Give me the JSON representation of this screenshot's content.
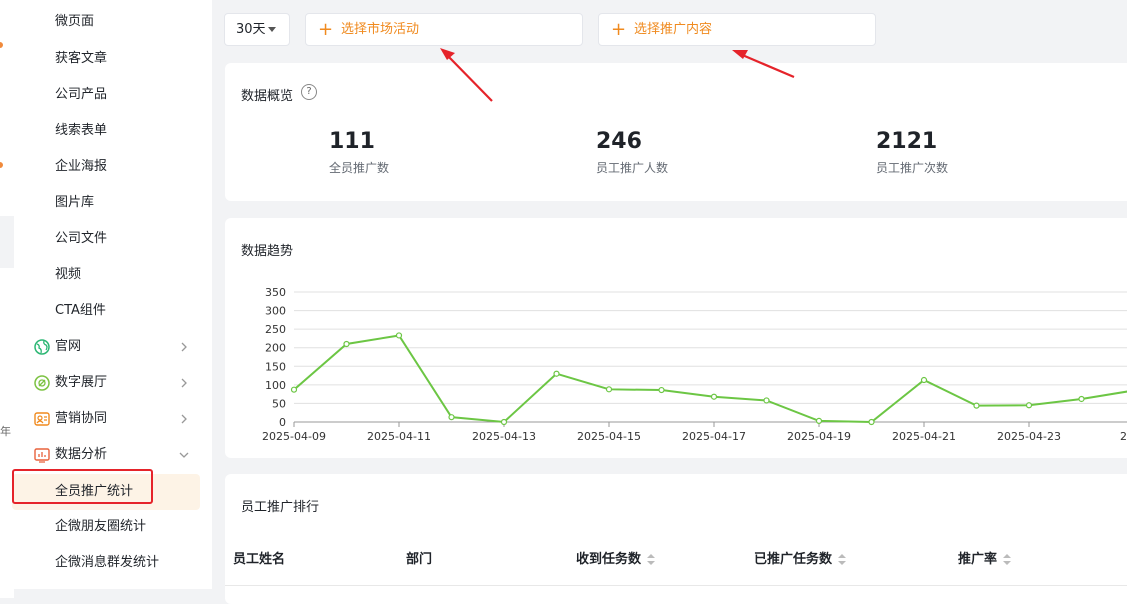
{
  "sidebar": {
    "items": [
      {
        "label": "微页面"
      },
      {
        "label": "获客文章"
      },
      {
        "label": "公司产品"
      },
      {
        "label": "线索表单"
      },
      {
        "label": "企业海报"
      },
      {
        "label": "图片库"
      },
      {
        "label": "公司文件"
      },
      {
        "label": "视频"
      },
      {
        "label": "CTA组件"
      }
    ],
    "groups": [
      {
        "label": "官网",
        "icon": "globe-icon"
      },
      {
        "label": "数字展厅",
        "icon": "hall-icon"
      },
      {
        "label": "营销协同",
        "icon": "collab-icon"
      },
      {
        "label": "数据分析",
        "icon": "analytics-icon"
      }
    ],
    "sub_items": [
      {
        "label": "全员推广统计",
        "active": true
      },
      {
        "label": "企微朋友圈统计"
      },
      {
        "label": "企微消息群发统计"
      }
    ],
    "edge_char": "年"
  },
  "toolbar": {
    "days": "30天",
    "pick_campaign": "选择市场活动",
    "pick_content": "选择推广内容"
  },
  "overview": {
    "title": "数据概览",
    "help": "?",
    "stats": [
      {
        "value": "111",
        "label": "全员推广数"
      },
      {
        "value": "246",
        "label": "员工推广人数"
      },
      {
        "value": "2121",
        "label": "员工推广次数"
      }
    ]
  },
  "trend": {
    "title": "数据趋势"
  },
  "chart_data": {
    "type": "line",
    "title": "数据趋势",
    "xlabel": "",
    "ylabel": "",
    "ylim": [
      0,
      350
    ],
    "yticks": [
      "0",
      "50",
      "100",
      "150",
      "200",
      "250",
      "300",
      "350"
    ],
    "x": [
      "2025-04-09",
      "2025-04-10",
      "2025-04-11",
      "2025-04-12",
      "2025-04-13",
      "2025-04-14",
      "2025-04-15",
      "2025-04-16",
      "2025-04-17",
      "2025-04-18",
      "2025-04-19",
      "2025-04-20",
      "2025-04-21",
      "2025-04-22",
      "2025-04-23",
      "2025-04-24",
      "2025-04-25"
    ],
    "xtick_labels": [
      "2025-04-09",
      "2025-04-11",
      "2025-04-13",
      "2025-04-15",
      "2025-04-17",
      "2025-04-19",
      "2025-04-21",
      "2025-04-23",
      "2025"
    ],
    "series": [
      {
        "values": [
          87,
          210,
          233,
          13,
          0,
          130,
          88,
          86,
          68,
          58,
          3,
          0,
          113,
          44,
          45,
          62,
          85
        ],
        "color": "#6cc644"
      }
    ],
    "grid": true
  },
  "ranking": {
    "title": "员工推广排行",
    "columns": [
      {
        "label": "员工姓名",
        "sortable": false
      },
      {
        "label": "部门",
        "sortable": false
      },
      {
        "label": "收到任务数",
        "sortable": true
      },
      {
        "label": "已推广任务数",
        "sortable": true
      },
      {
        "label": "推广率",
        "sortable": true
      }
    ]
  },
  "colors": {
    "accent": "#f08a1e",
    "annotation": "#e5232a",
    "line": "#6cc644"
  }
}
